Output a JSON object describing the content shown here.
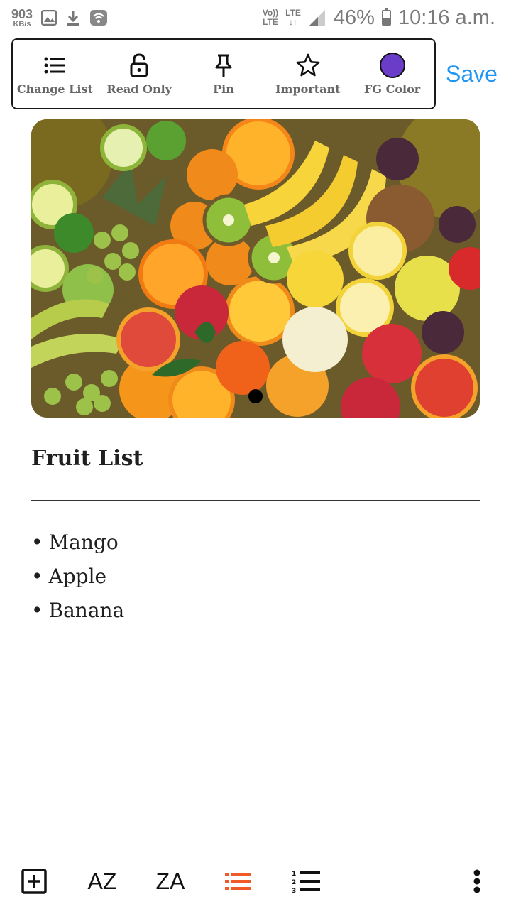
{
  "status_bar": {
    "net_speed": "903",
    "net_unit": "KB/s",
    "volte_label": "Vo))",
    "volte_sub": "LTE",
    "lte_label": "LTE",
    "lte_arrows": "↓↑",
    "battery_percent": "46%",
    "battery_level": 0.46,
    "time": "10:16 a.m."
  },
  "toolbar": {
    "items": [
      {
        "label": "Change List",
        "icon": "list-icon"
      },
      {
        "label": "Read Only",
        "icon": "unlock-icon"
      },
      {
        "label": "Pin",
        "icon": "pin-icon"
      },
      {
        "label": "Important",
        "icon": "star-icon"
      },
      {
        "label": "FG Color",
        "icon": "color-swatch"
      }
    ],
    "fg_color": "#6a3cc8",
    "save_label": "Save",
    "save_color": "#2196f3"
  },
  "note": {
    "title": "Fruit List",
    "items": [
      "Mango",
      "Apple",
      "Banana"
    ],
    "bullet": "•"
  },
  "bottom_bar": {
    "az_label": "AZ",
    "za_label": "ZA",
    "accent_color": "#f05a28"
  }
}
